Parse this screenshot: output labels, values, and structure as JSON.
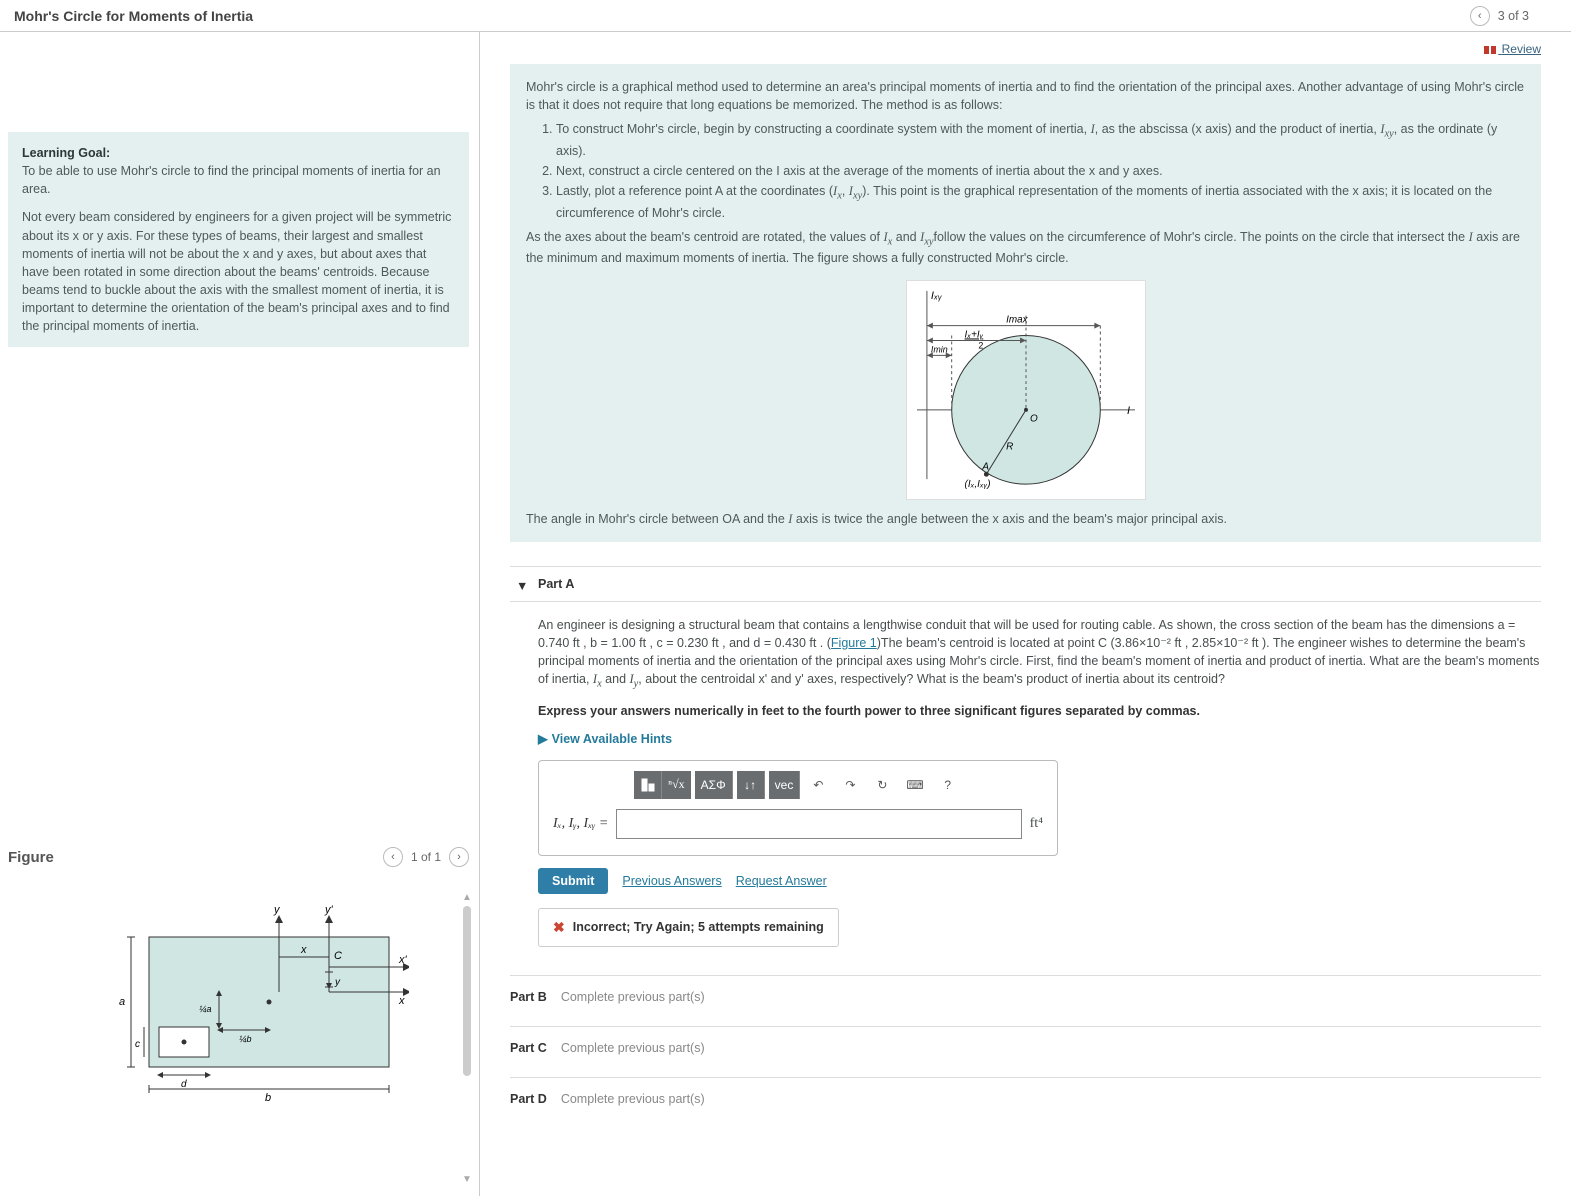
{
  "header": {
    "title": "Mohr's Circle for Moments of Inertia",
    "pager": "3 of 3"
  },
  "review_label": "Review",
  "goal": {
    "heading": "Learning Goal:",
    "line1": "To be able to use Mohr's circle to find the principal moments of inertia for an area.",
    "line2": "Not every beam considered by engineers for a given project will be symmetric about its x or y axis. For these types of beams, their largest and smallest moments of inertia will not be about the x and y axes, but about axes that have been rotated in some direction about the beams' centroids. Because beams tend to buckle about the axis with the smallest moment of inertia, it is important to determine the orientation of the beam's principal axes and to find the principal moments of inertia."
  },
  "intro": {
    "p1": "Mohr's circle is a graphical method used to determine an area's principal moments of inertia and to find the orientation of the principal axes. Another advantage of using Mohr's circle is that it does not require that long equations be memorized. The method is as follows:",
    "li1a": "To construct Mohr's circle, begin by constructing a coordinate system with the moment of inertia, ",
    "li1b": ", as the abscissa (x axis) and the product of inertia, ",
    "li1c": ", as the ordinate (y axis).",
    "li2": "Next, construct a circle centered on the I axis at the average of the moments of inertia about the x and y axes.",
    "li3a": "Lastly, plot a reference point A at the coordinates (",
    "li3b": "). This point is the graphical representation of the moments of inertia associated with the x axis; it is located on the circumference of Mohr's circle.",
    "p2a": "As the axes about the beam's centroid are rotated, the values of ",
    "p2b": " and ",
    "p2c": "follow the values on the circumference of Mohr's circle. The points on the circle that intersect the ",
    "p2d": " axis are the minimum and maximum moments of inertia. The figure shows a fully constructed Mohr's circle.",
    "p3a": "The angle in Mohr's circle between OA and the ",
    "p3b": " axis is twice the angle between the x axis and the beam's major principal axis."
  },
  "partA": {
    "label": "Part A",
    "body_a": "An engineer is designing a structural beam that contains a lengthwise conduit that will be used for routing cable. As shown, the cross section of the beam has the dimensions ",
    "dims": "a = 0.740 ft , b = 1.00 ft , c = 0.230 ft , and d = 0.430 ft ",
    "body_b": ". (",
    "figlink": "Figure 1",
    "body_c": ")The beam's centroid is located at point C (3.86×10⁻² ft , 2.85×10⁻² ft ). The engineer wishes to determine the beam's principal moments of inertia and the orientation of the principal axes using Mohr's circle. First, find the beam's moment of inertia and product of inertia. What are the beam's moments of inertia, ",
    "body_d": " and ",
    "body_e": ", about the centroidal x' and y' axes, respectively? What is the beam's product of inertia about its centroid?",
    "express": "Express your answers numerically in feet to the fourth power to three significant figures separated by commas.",
    "hints": "View Available Hints",
    "lhs": "Iₓ, Iᵧ, Iₓᵧ =",
    "unit": "ft⁴",
    "toolbar": {
      "greek": "ΑΣΦ",
      "sub": "↓↑",
      "vec": "vec"
    }
  },
  "actions": {
    "submit": "Submit",
    "prev": "Previous Answers",
    "req": "Request Answer"
  },
  "feedback": "Incorrect; Try Again; 5 attempts remaining",
  "locked": {
    "b": "Part B",
    "c": "Part C",
    "d": "Part D",
    "msg": "Complete previous part(s)"
  },
  "figure": {
    "heading": "Figure",
    "pager": "1 of 1"
  },
  "mohr_labels": {
    "Ixy": "Iₓᵧ",
    "Imax": "Imax",
    "Imin": "Imin",
    "avg": "Iₓ+Iᵧ",
    "two": "2",
    "O": "O",
    "R": "R",
    "A": "A",
    "IxIxy": "(Iₓ,Iₓᵧ)",
    "I": "I"
  },
  "beam_labels": {
    "y": "y",
    "yp": "y'",
    "x": "x",
    "xp": "x'",
    "xaxis": "x",
    "yshort": "y",
    "C": "C",
    "a": "a",
    "b": "b",
    "c": "c",
    "d": "d",
    "qa": "¼a",
    "qb": "¼b"
  }
}
